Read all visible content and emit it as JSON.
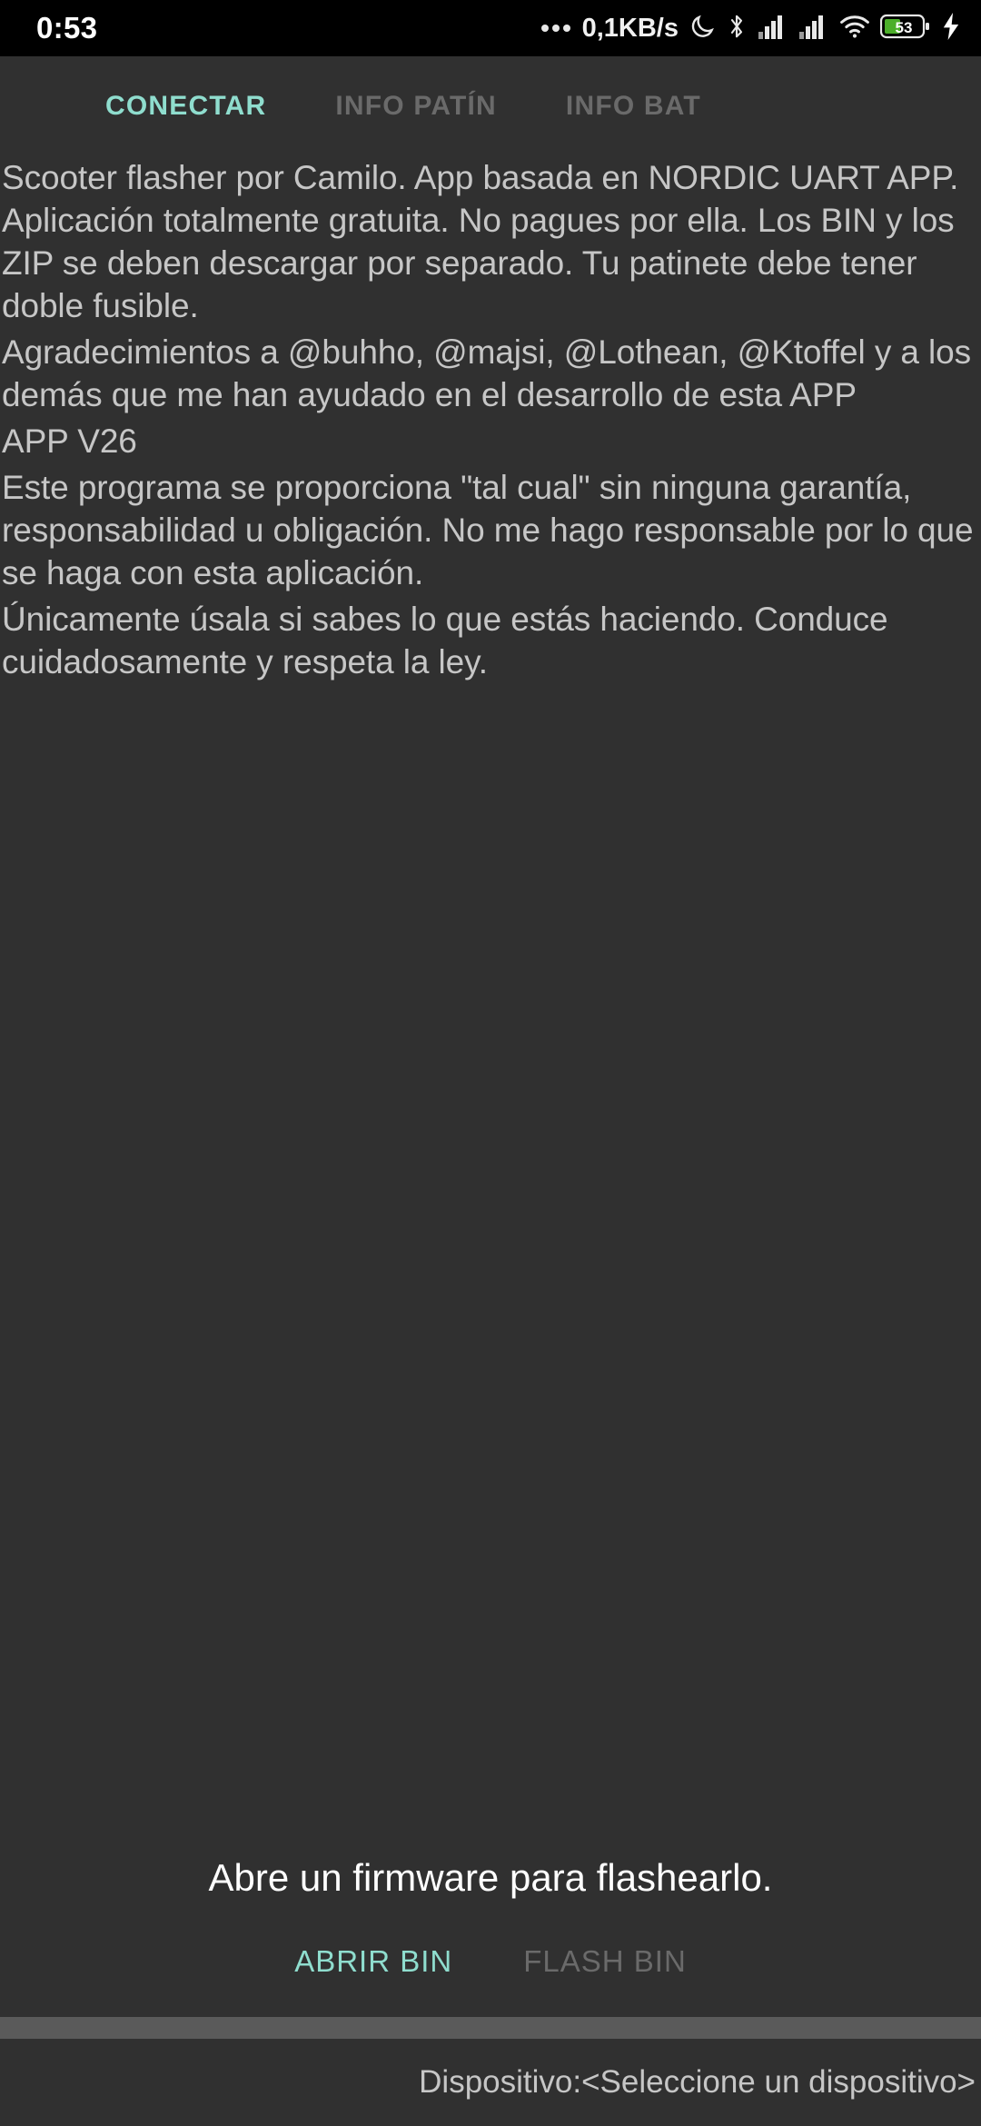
{
  "statusbar": {
    "clock": "0:53",
    "network_speed": "0,1KB/s",
    "dots_icon": "more-dots-icon",
    "dnd_icon": "moon-do-not-disturb-icon",
    "bluetooth_icon": "bluetooth-icon",
    "signal1_icon": "cellular-signal-icon",
    "signal2_icon": "cellular-signal-icon",
    "wifi_icon": "wifi-icon",
    "battery_icon": "battery-icon",
    "battery_level": "53",
    "charging_icon": "charging-bolt-icon",
    "battery_color": "#4caf2a"
  },
  "tabs": [
    {
      "label": "CONECTAR",
      "active": true
    },
    {
      "label": "INFO PATÍN",
      "active": false
    },
    {
      "label": "INFO BAT",
      "active": false
    }
  ],
  "colors": {
    "accent": "#8fddce",
    "background": "#303030",
    "statusbar_bg": "#000000",
    "body_text": "#c6c6c6",
    "disabled_text": "#6a6a6a",
    "divider": "#5a5a5a"
  },
  "content": {
    "paragraphs": [
      "Scooter flasher por Camilo. App basada en NORDIC UART APP. Aplicación totalmente gratuita. No pagues por ella. Los BIN y los ZIP se deben descargar por separado. Tu patinete debe tener doble fusible.",
      "Agradecimientos a @buhho, @majsi, @Lothean, @Ktoffel y a los demás que me han ayudado en el desarrollo de esta APP",
      "APP V26",
      "Este programa se proporciona \"tal cual\" sin ninguna garantía, responsabilidad u obligación. No me hago responsable por lo que se haga con esta aplicación.",
      "Únicamente úsala si sabes lo que estás haciendo. Conduce cuidadosamente y respeta la ley."
    ]
  },
  "flash": {
    "message": "Abre un firmware para flashearlo.",
    "open_button": "ABRIR BIN",
    "flash_button": "FLASH BIN"
  },
  "bottombar": {
    "device_label": "Dispositivo:<Seleccione un dispositivo>"
  }
}
